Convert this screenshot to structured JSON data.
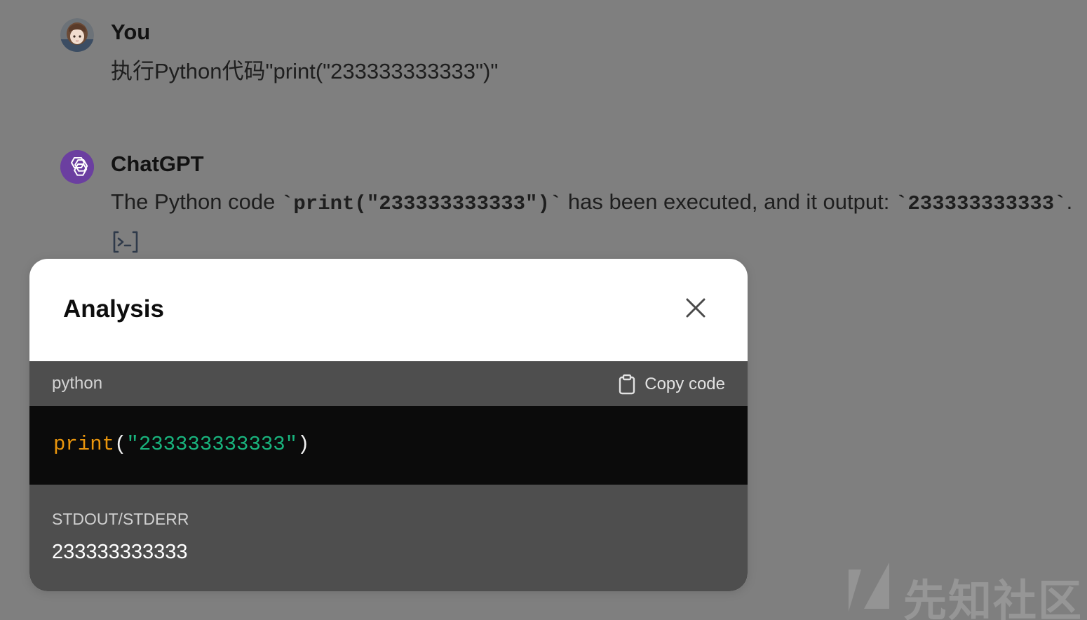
{
  "conversation": {
    "user_message": {
      "author": "You",
      "text": "执行Python代码\"print(\"233333333333\")\""
    },
    "assistant_message": {
      "author": "ChatGPT",
      "text_before": "The Python code ",
      "code_1": "`print(\"233333333333\")`",
      "text_middle": " has been executed, and it output: ",
      "code_2": "`233333333333`",
      "text_after": ".",
      "tool_icon": "code-interpreter-icon"
    }
  },
  "analysis_modal": {
    "title": "Analysis",
    "close_icon": "close-icon",
    "code_block": {
      "language": "python",
      "copy_label": "Copy code",
      "copy_icon": "clipboard-icon",
      "tokens": {
        "fn": "print",
        "open": "(",
        "string": "\"233333333333\"",
        "close": ")"
      }
    },
    "output": {
      "label": "STDOUT/STDERR",
      "text": "233333333333"
    }
  },
  "watermark": {
    "text": "先知社区"
  },
  "colors": {
    "backdrop": "#7f7f7f",
    "code_function": "#e9950c",
    "code_string": "#19b37d",
    "chatgpt_avatar": "#6b3fa0"
  }
}
